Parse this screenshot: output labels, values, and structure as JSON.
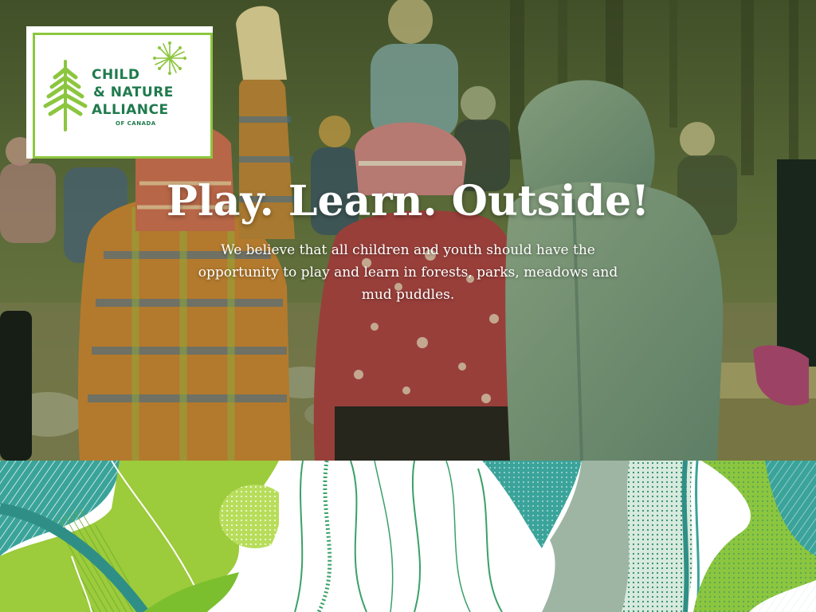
{
  "logo": {
    "line1": "CHILD",
    "line2": "& NATURE",
    "line3": "ALLIANCE",
    "sub": "OF CANADA",
    "icon_tree": "tree-icon",
    "icon_burst": "dandelion-icon"
  },
  "hero": {
    "headline": "Play. Learn. Outside!",
    "tagline": "We believe that all children and youth should have the opportunity to play and learn in forests, parks, meadows and mud puddles."
  },
  "colors": {
    "brand_green": "#1f7a4d",
    "accent_lime": "#8cc63f",
    "teal": "#3aa39a"
  }
}
